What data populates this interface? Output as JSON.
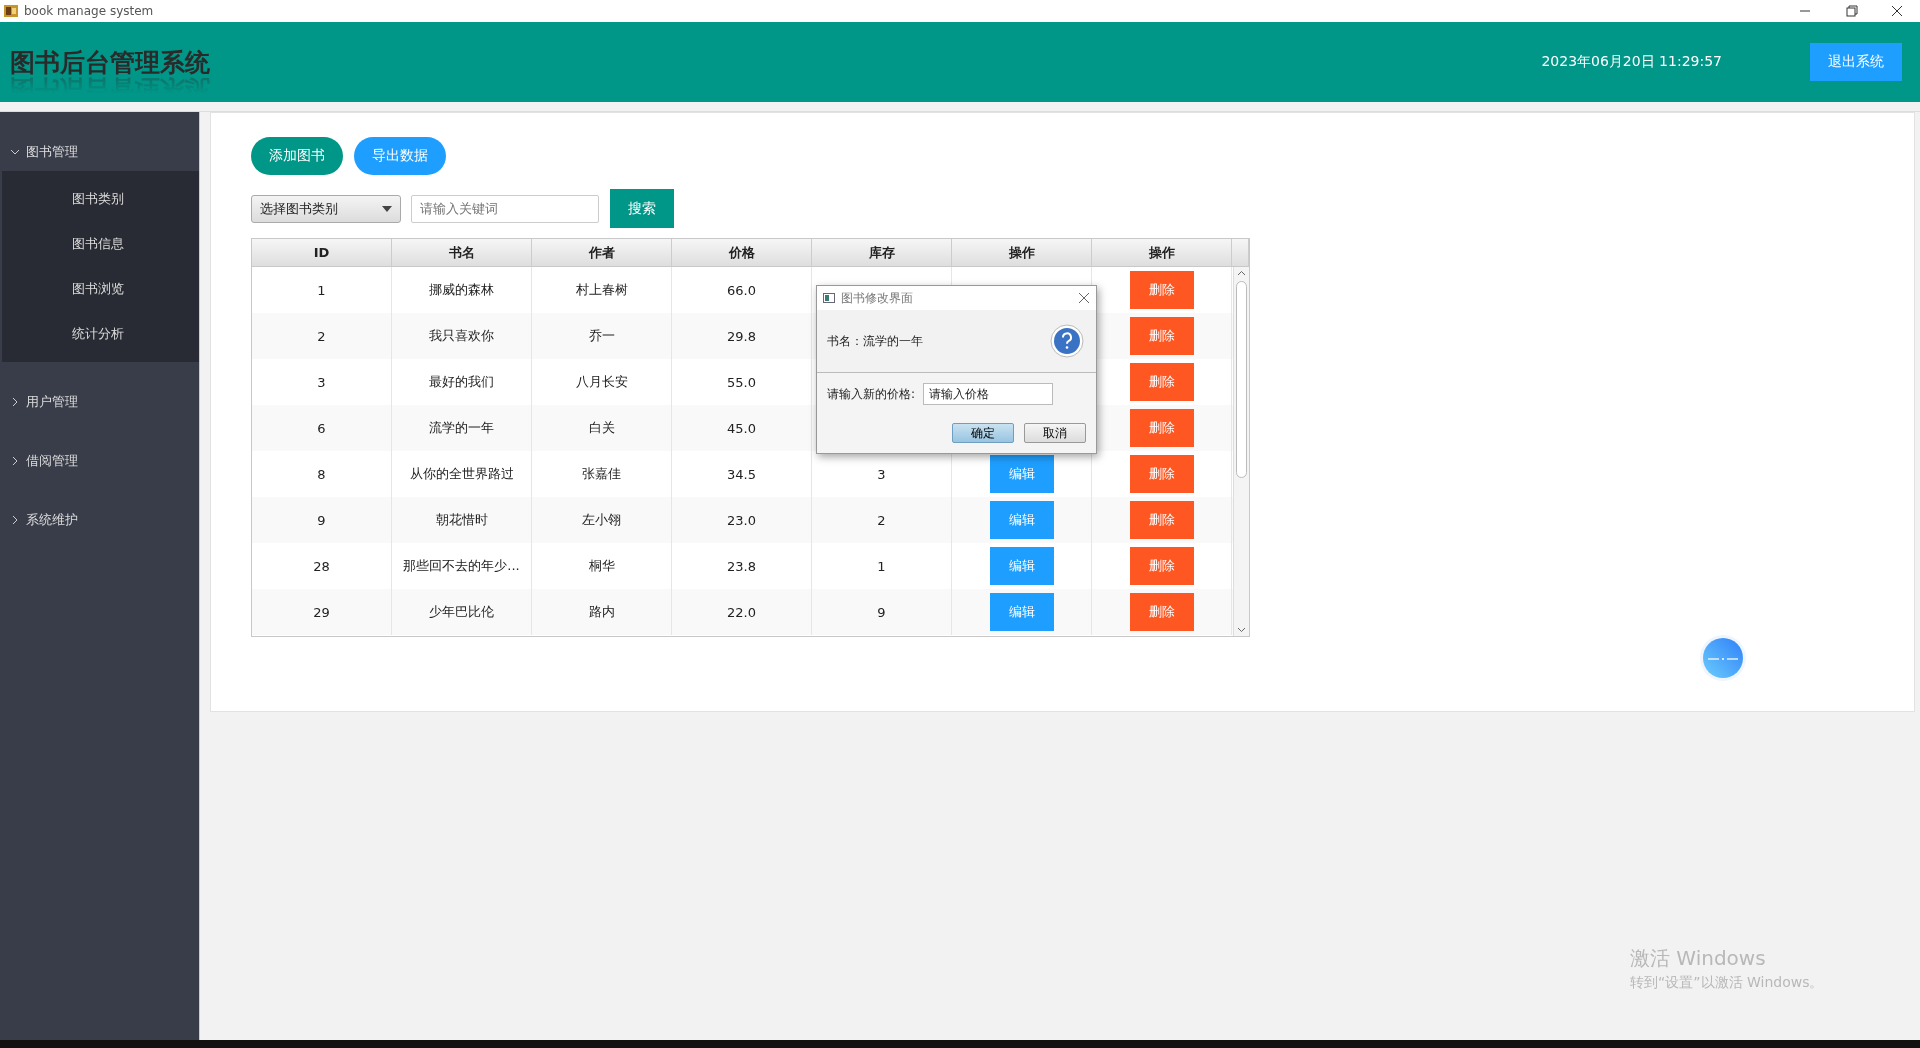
{
  "window": {
    "title": "book manage system"
  },
  "header": {
    "title": "图书后台管理系统",
    "datetime": "2023年06月20日 11:29:57",
    "logout": "退出系统"
  },
  "sidebar": {
    "groups": [
      {
        "label": "图书管理",
        "expanded": true,
        "children": [
          {
            "label": "图书类别"
          },
          {
            "label": "图书信息"
          },
          {
            "label": "图书浏览"
          },
          {
            "label": "统计分析"
          }
        ]
      },
      {
        "label": "用户管理",
        "expanded": false
      },
      {
        "label": "借阅管理",
        "expanded": false
      },
      {
        "label": "系统维护",
        "expanded": false
      }
    ]
  },
  "toolbar": {
    "add": "添加图书",
    "export": "导出数据",
    "category": "选择图书类别",
    "search_placeholder": "请输入关键词",
    "search": "搜索"
  },
  "table": {
    "columns": [
      "ID",
      "书名",
      "作者",
      "价格",
      "库存",
      "操作",
      "操作"
    ],
    "rows": [
      {
        "cells": [
          "1",
          "挪威的森林",
          "村上春树",
          "66.0"
        ],
        "delete": "删除"
      },
      {
        "cells": [
          "2",
          "我只喜欢你",
          "乔一",
          "29.8"
        ],
        "delete": "删除"
      },
      {
        "cells": [
          "3",
          "最好的我们",
          "八月长安",
          "55.0"
        ],
        "delete": "删除"
      },
      {
        "cells": [
          "6",
          "流学的一年",
          "白关",
          "45.0"
        ],
        "delete": "删除"
      },
      {
        "cells": [
          "8",
          "从你的全世界路过",
          "张嘉佳",
          "34.5",
          "3"
        ],
        "edit": "编辑",
        "delete": "删除"
      },
      {
        "cells": [
          "9",
          "朝花惜时",
          "左小翎",
          "23.0",
          "2"
        ],
        "edit": "编辑",
        "delete": "删除"
      },
      {
        "cells": [
          "28",
          "那些回不去的年少...",
          "桐华",
          "23.8",
          "1"
        ],
        "edit": "编辑",
        "delete": "删除"
      },
      {
        "cells": [
          "29",
          "少年巴比伦",
          "路内",
          "22.0",
          "9"
        ],
        "edit": "编辑",
        "delete": "删除"
      }
    ]
  },
  "dialog": {
    "title": "图书修改界面",
    "message": "书名：流学的一年",
    "prompt": "请输入新的价格:",
    "value": "请输入价格",
    "buttons": [
      {
        "label": "确定",
        "default": true
      },
      {
        "label": "取消",
        "default": false
      }
    ]
  },
  "activation": {
    "title": "激活 Windows",
    "subtitle": "转到“设置”以激活 Windows。"
  }
}
